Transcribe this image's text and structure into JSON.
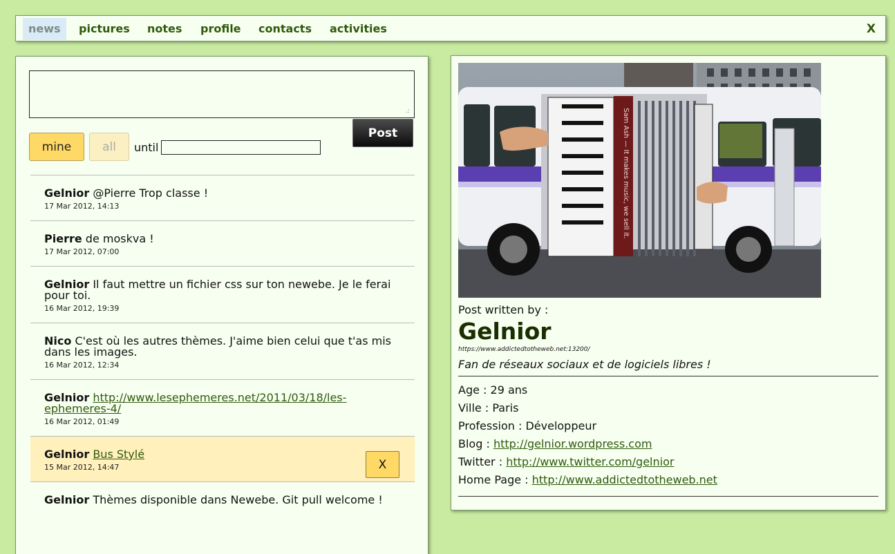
{
  "nav": {
    "items": [
      "news",
      "pictures",
      "notes",
      "profile",
      "contacts",
      "activities"
    ],
    "close_label": "X"
  },
  "composer": {
    "post_label": "Post",
    "mine_label": "mine",
    "all_label": "all",
    "until_label": "until",
    "resize_grip": ".:"
  },
  "feed": [
    {
      "author": "Gelnior",
      "text": "@Pierre Trop classe !",
      "link": "",
      "date": "17 Mar 2012, 14:13"
    },
    {
      "author": "Pierre",
      "text": "de moskva !",
      "link": "",
      "date": "17 Mar 2012, 07:00"
    },
    {
      "author": "Gelnior",
      "text": "Il faut mettre un fichier css sur ton newebe. Je le ferai pour toi.",
      "link": "",
      "date": "16 Mar 2012, 19:39"
    },
    {
      "author": "Nico",
      "text": "C'est où les autres thèmes. J'aime bien celui que t'as mis dans les images.",
      "link": "",
      "date": "16 Mar 2012, 12:34"
    },
    {
      "author": "Gelnior",
      "text": "",
      "link": "http://www.lesephemeres.net/2011/03/18/les-ephemeres-4/",
      "date": "16 Mar 2012, 01:49"
    },
    {
      "author": "Gelnior",
      "text": "",
      "link": "Bus Stylé",
      "date": "15 Mar 2012, 14:47",
      "delete_label": "X"
    },
    {
      "author": "Gelnior",
      "text": "Thèmes disponible dans Newebe. Git pull welcome !",
      "link": "",
      "date": ""
    }
  ],
  "profile": {
    "written_by": "Post written by :",
    "name": "Gelnior",
    "url": "https://www.addictedtotheweb.net:13200/",
    "description": "Fan de réseaux sociaux et de logiciels libres !",
    "age": "Age : 29 ans",
    "city": "Ville : Paris",
    "job": "Profession : Développeur",
    "blog_label": "Blog :",
    "blog_url": "http://gelnior.wordpress.com",
    "twitter_label": "Twitter :",
    "twitter_url": "http://www.twitter.com/gelnior",
    "home_label": "Home Page :",
    "home_url": "http://www.addictedtotheweb.net"
  },
  "photo": {
    "bus_lettering": "Sam Ash — It makes music, we sell it."
  },
  "colors": {
    "background": "#c8eba1",
    "panel": "#f7fff0",
    "link": "#2f5a0d",
    "accent_yellow": "#ffd966",
    "selected_row": "#fff0bc"
  }
}
